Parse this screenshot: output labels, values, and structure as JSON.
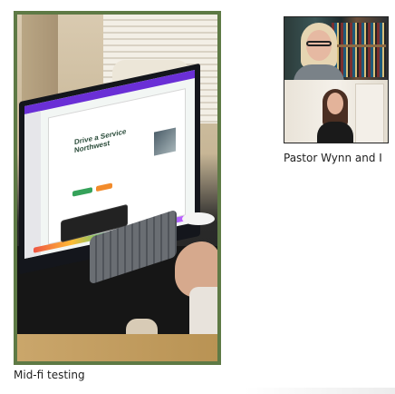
{
  "cards": [
    {
      "caption": "Mid-fi testing",
      "frame_color": "#5e7a45"
    },
    {
      "caption": "Pastor Wynn and I"
    }
  ],
  "screen": {
    "slide_headline": "Drive a Service Northwest"
  },
  "colors": {
    "background": "#ffffff",
    "text": "#1f1f1f"
  }
}
